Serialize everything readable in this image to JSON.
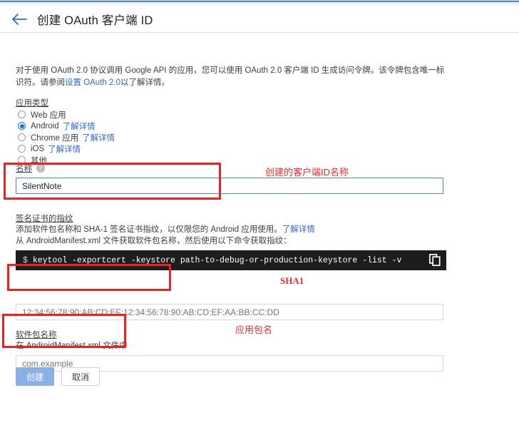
{
  "header": {
    "title": "创建 OAuth 客户端 ID",
    "back_icon": "arrow-left-icon"
  },
  "description": {
    "part1": "对于使用 OAuth 2.0 协议调用 Google API 的应用，您可以使用 OAuth 2.0 客户端 ID 生成访问令牌。该令牌包含唯一标识符。请参阅",
    "link": "设置 OAuth 2.0",
    "part2": "以了解详情。"
  },
  "application_type": {
    "label": "应用类型",
    "options": [
      {
        "label": "Web 应用",
        "link": "",
        "selected": false
      },
      {
        "label": "Android",
        "link": "了解详情",
        "selected": true
      },
      {
        "label": "Chrome 应用",
        "link": "了解详情",
        "selected": false
      },
      {
        "label": "iOS",
        "link": "了解详情",
        "selected": false
      },
      {
        "label": "其他",
        "link": "",
        "selected": false
      }
    ]
  },
  "name_field": {
    "label": "名称",
    "help_icon": "help-circle-icon",
    "value": "SilentNote"
  },
  "fingerprint": {
    "title": "签名证书的指纹",
    "line1": "添加软件包名称和 SHA-1 签名证书指纹，以仅限您的 Android 应用使用。",
    "line1_link": "了解详情",
    "line2": "从 AndroidManifest.xml 文件获取软件包名称，然后使用以下命令获取指纹：",
    "command_prompt": "$",
    "command": "keytool -exportcert -keystore path-to-debug-or-production-keystore -list -v",
    "copy_icon": "copy-icon",
    "sha_placeholder": "12:34:56:78:90:AB:CD:EF:12:34:56:78:90:AB:CD:EF:AA:BB:CC:DD"
  },
  "package_field": {
    "label": "软件包名称",
    "sub_label": "在 AndroidManifest.xml 文件中",
    "placeholder": "com.example"
  },
  "buttons": {
    "create": "创建",
    "cancel": "取消"
  },
  "annotations": {
    "name_note": "创建的客户端ID名称",
    "sha_note": "SHA1",
    "package_note": "应用包名",
    "color": "#f22b2b"
  }
}
